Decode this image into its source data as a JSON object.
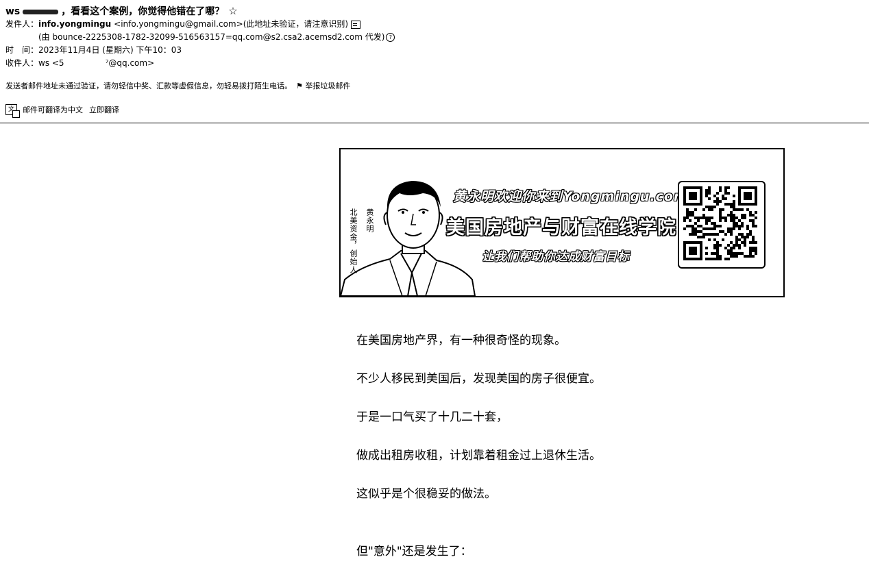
{
  "email": {
    "subject_prefix": "ws",
    "subject": "，看看这个案例，你觉得他错在了哪？",
    "star": "☆",
    "from_label": "发件人：",
    "from_name": "info.yongmingu",
    "from_address": "<info.yongmingu@gmail.com>",
    "from_note": "(此地址未验证，请注意识别)",
    "via": "(由 bounce-2225308-1782-32099-516563157=qq.com@s2.csa2.acemsd2.com 代发)",
    "time_label": "时　间：",
    "time": "2023年11月4日 (星期六) 下午10：03",
    "to_label": "收件人：",
    "to_prefix": "ws <5",
    "to_suffix": "⁷@qq.com>",
    "warning": "发送者邮件地址未通过验证，请勿轻信中奖、汇款等虚假信息，勿轻易拨打陌生电话。",
    "report_spam": "举报垃圾邮件",
    "translate_hint": "邮件可翻译为中文",
    "translate_now": "立即翻译"
  },
  "banner": {
    "line1": "黄永明欢迎你来到Yongmingu.com",
    "line2": "美国房地产与财富在线学院",
    "line3": "让我们帮助你达成财富目标",
    "name": "黄永明",
    "title": "北美资金，创始人"
  },
  "body": {
    "paragraphs": [
      "在美国房地产界，有一种很奇怪的现象。",
      "不少人移民到美国后，发现美国的房子很便宜。",
      "于是一口气买了十几二十套，",
      "做成出租房收租，计划靠着租金过上退休生活。",
      "这似乎是个很稳妥的做法。",
      "但\"意外\"还是发生了："
    ]
  }
}
